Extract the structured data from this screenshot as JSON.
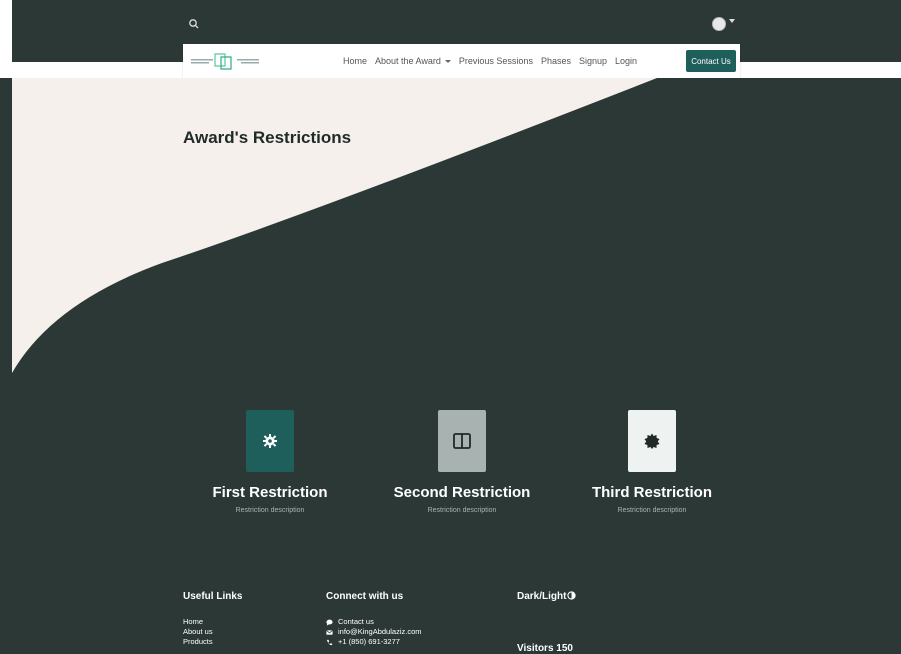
{
  "nav": {
    "links": [
      "Home",
      "About the Award",
      "Previous Sessions",
      "Phases",
      "Signup",
      "Login"
    ],
    "contact_label": "Contact Us"
  },
  "page": {
    "title": "Award's Restrictions"
  },
  "colors": {
    "accent": "#1e5f5c",
    "dark_bg": "#2b3836",
    "light_bg": "#f5f0ec"
  },
  "cards": [
    {
      "title": "First Restriction",
      "desc": "Restriction description",
      "icon": "gear-icon",
      "bg": "#1e5f5c"
    },
    {
      "title": "Second Restriction",
      "desc": "Restriction description",
      "icon": "columns-icon",
      "bg": "#a8b2b1"
    },
    {
      "title": "Third Restriction",
      "desc": "Restriction description",
      "icon": "badge-icon",
      "bg": "#eef2f1"
    }
  ],
  "footer": {
    "useful_links_title": "Useful Links",
    "useful_links": [
      "Home",
      "About us",
      "Products"
    ],
    "connect_title": "Connect with us",
    "connect": [
      "Contact us",
      "info@KingAbdulaziz.com",
      "+1 (850) 691-3277"
    ],
    "theme_toggle": "Dark/Light",
    "visitors": "Visitors 150"
  }
}
